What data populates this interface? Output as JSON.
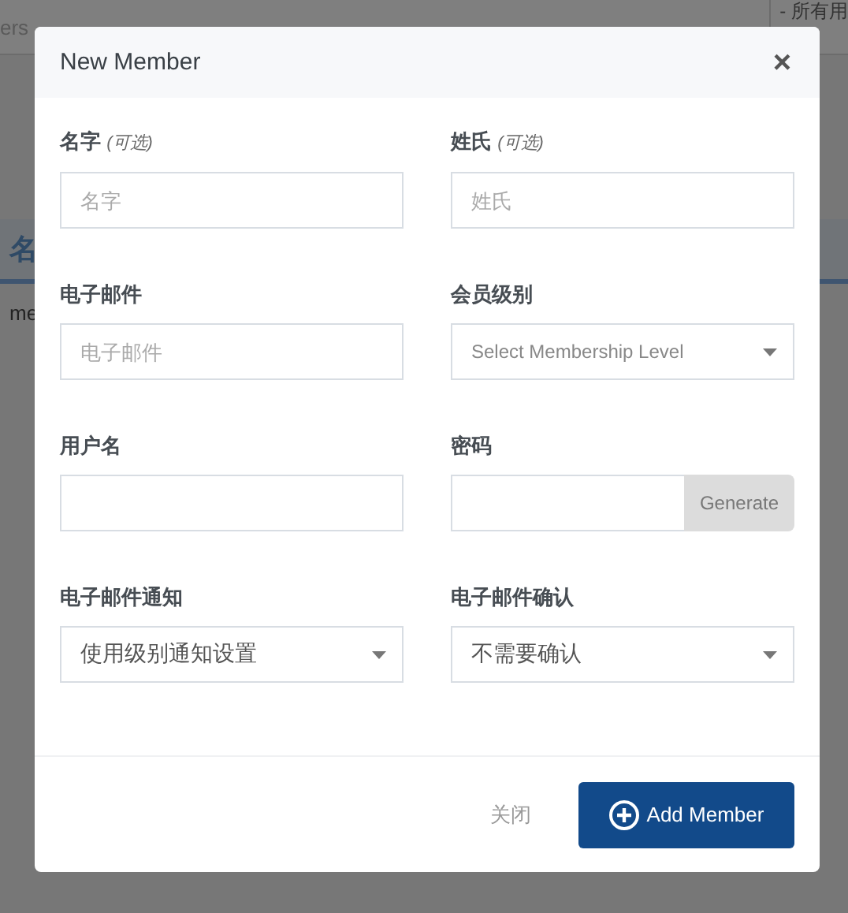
{
  "background": {
    "search_text": "ers",
    "filter_text": "- 所有用",
    "column_header": "名",
    "cell_text": "me"
  },
  "dialog": {
    "title": "New Member",
    "close": "×",
    "fields": [
      {
        "label": "名字",
        "hint": "(可选)",
        "kind": "text",
        "placeholder": "名字"
      },
      {
        "label": "姓氏",
        "hint": "(可选)",
        "kind": "text",
        "placeholder": "姓氏"
      },
      {
        "label": "电子邮件",
        "kind": "text",
        "placeholder": "电子邮件"
      },
      {
        "label": "会员级别",
        "kind": "select",
        "placeholder": "Select Membership Level"
      },
      {
        "label": "用户名",
        "kind": "text"
      },
      {
        "label": "密码",
        "kind": "password",
        "button": "Generate"
      },
      {
        "label": "电子邮件通知",
        "kind": "select",
        "value": "使用级别通知设置"
      },
      {
        "label": "电子邮件确认",
        "kind": "select",
        "value": "不需要确认"
      }
    ],
    "buttons": {
      "close": "关闭",
      "add": "Add Member"
    }
  }
}
